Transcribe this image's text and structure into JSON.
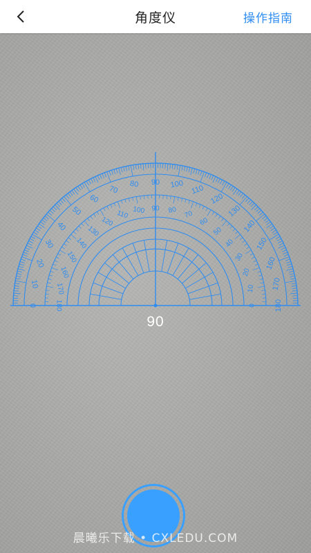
{
  "header": {
    "back_label": "<",
    "title": "角度仪",
    "guide_label": "操作指南"
  },
  "protractor": {
    "color": "#2f8cf0",
    "outer_scale": [
      "0",
      "10",
      "20",
      "30",
      "40",
      "50",
      "60",
      "70",
      "80",
      "90",
      "100",
      "110",
      "120",
      "130",
      "140",
      "150",
      "160",
      "170",
      "180"
    ],
    "inner_scale": [
      "180",
      "170",
      "160",
      "150",
      "140",
      "130",
      "120",
      "110",
      "100",
      "90",
      "80",
      "70",
      "60",
      "50",
      "40",
      "30",
      "20",
      "10",
      "0"
    ]
  },
  "readout": {
    "angle": "90"
  },
  "shutter": {
    "accent": "#3aa0ff"
  },
  "watermark": {
    "text": "晨曦乐下载 • CXLEDU.COM"
  }
}
